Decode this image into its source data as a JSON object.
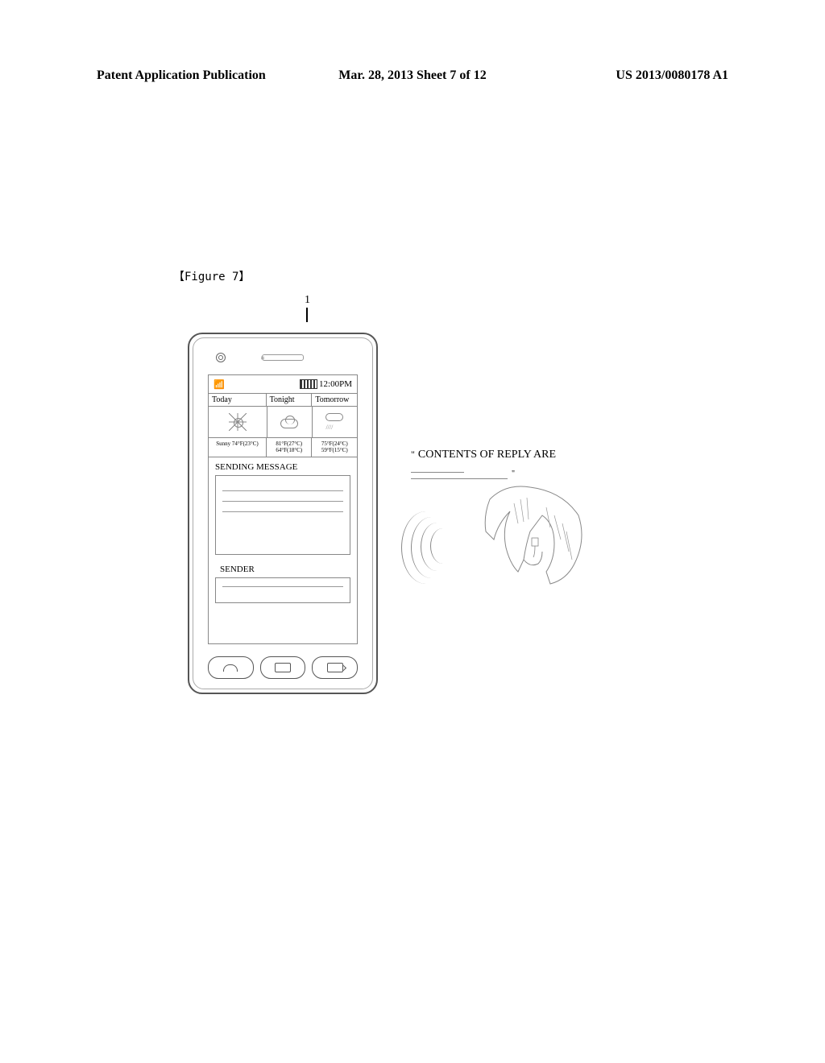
{
  "header": {
    "left": "Patent Application Publication",
    "center": "Mar. 28, 2013  Sheet 7 of 12",
    "right": "US 2013/0080178 A1"
  },
  "figure_label": "【Figure 7】",
  "reference_number": "1",
  "phone": {
    "status": {
      "signal": "▮▮▮▮",
      "time": "12:00PM"
    },
    "weather": {
      "labels": [
        "Today",
        "Tonight",
        "Tomorrow"
      ],
      "today_temp": "Sunny 74°F(23°C)",
      "tonight_hi": "81°F(27°C)",
      "tonight_lo": "64°F(18°C)",
      "tomorrow_hi": "75°F(24°C)",
      "tomorrow_lo": "59°F(15°C)"
    },
    "message_heading": "SENDING MESSAGE",
    "sender_heading": "SENDER"
  },
  "reply": {
    "quote_start": "\"",
    "text": "CONTENTS OF REPLY ARE",
    "quote_end": "\""
  }
}
